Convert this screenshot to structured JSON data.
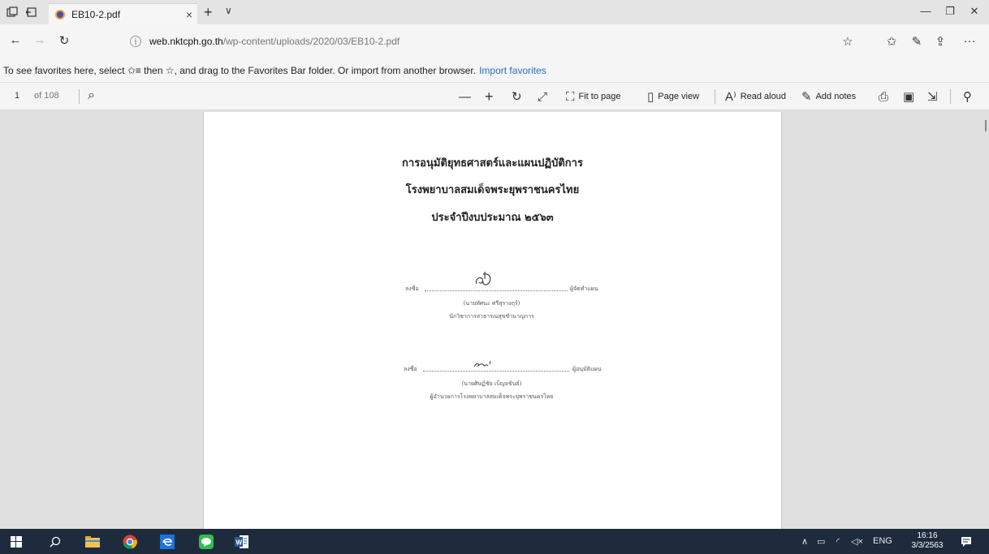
{
  "window": {
    "tab_title": "EB10-2.pdf",
    "tab_close": "×",
    "new_tab": "+",
    "tab_menu": "∨",
    "minimize": "—",
    "restore": "❐",
    "close": "✕"
  },
  "address": {
    "url_host": "web.nktcph.go.th",
    "url_path": "/wp-content/uploads/2020/03/EB10-2.pdf"
  },
  "favorites_bar": {
    "message": "To see favorites here, select ✩≡ then ☆, and drag to the Favorites Bar folder. Or import from another browser.",
    "import_link": "Import favorites"
  },
  "pdf_toolbar": {
    "page_number": "1",
    "page_count": "of 108",
    "fit_to_page": "Fit to page",
    "page_view": "Page view",
    "read_aloud": "Read aloud",
    "add_notes": "Add notes"
  },
  "document": {
    "title_line1": "การอนุมัติยุทธศาสตร์และแผนปฏิบัติการ",
    "title_line2": "โรงพยาบาลสมเด็จพระยุพราชนครไทย",
    "title_line3": "ประจำปีงบประมาณ ๒๕๖๓",
    "sig1_prefix": "ลงชื่อ",
    "sig1_role": "ผู้จัดทำแผน",
    "sig1_name": "(นายทัศนะ ศรีสุรางฤร์)",
    "sig1_position": "นักวิชาการสาธารณสุขชำนาญการ",
    "sig2_prefix": "ลงชื่อ",
    "sig2_role": "ผู้อนุมัติแผน",
    "sig2_name": "(นายศิษฏ์ชัย เบ็ญจขันธ์)",
    "sig2_position": "ผู้อำนวยการโรงพยาบาลสมเด็จพระยุพราชนครไทย"
  },
  "taskbar": {
    "language": "ENG",
    "time": "16:16",
    "date": "3/3/2563"
  },
  "colors": {
    "taskbar": "#1e2b3c",
    "link": "#2b6cc4",
    "viewer_bg": "#e0e0e0"
  }
}
